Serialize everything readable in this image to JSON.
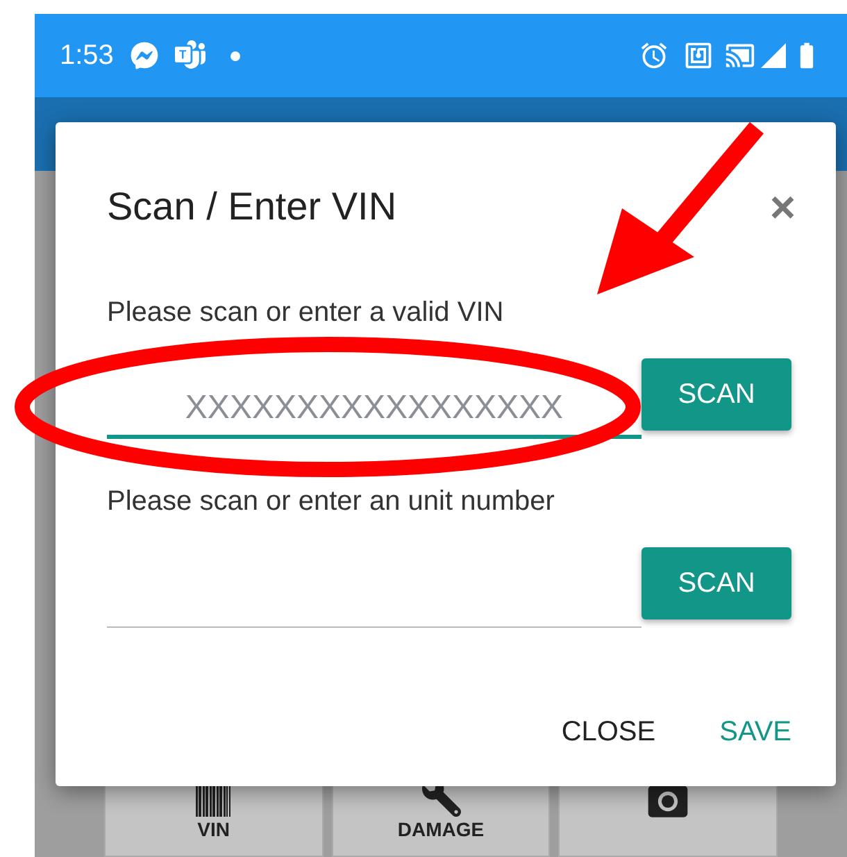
{
  "status_bar": {
    "time": "1:53"
  },
  "dialog": {
    "title": "Scan / Enter VIN",
    "close_icon": "×",
    "fields": [
      {
        "label": "Please scan or enter a valid VIN",
        "placeholder": "XXXXXXXXXXXXXXXXX",
        "focused": true,
        "button": "SCAN"
      },
      {
        "label": "Please scan or enter an unit number",
        "focused": false,
        "button": "SCAN"
      }
    ],
    "actions": [
      {
        "label": "CLOSE",
        "kind": "neutral"
      },
      {
        "label": "SAVE",
        "kind": "primary"
      }
    ]
  },
  "bottom_tabs": [
    {
      "label": "VIN",
      "kind": "barcode"
    },
    {
      "label": "DAMAGE",
      "kind": "wrench"
    },
    {
      "kind": "camera"
    }
  ]
}
